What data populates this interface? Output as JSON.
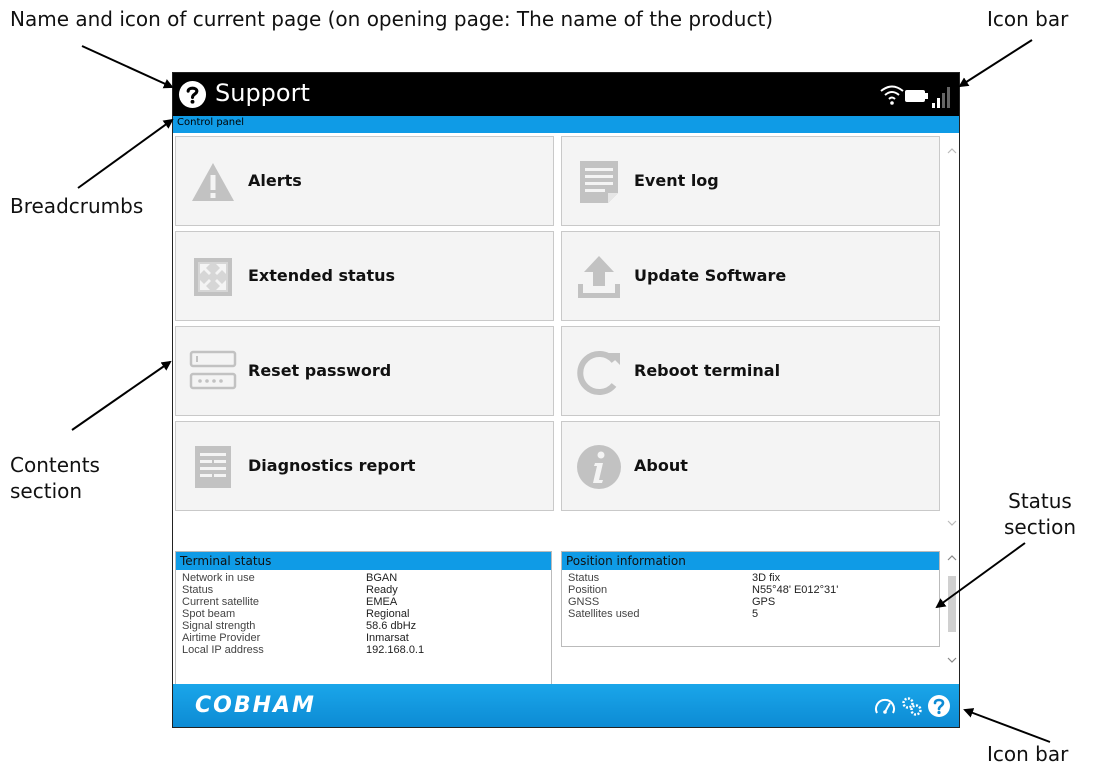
{
  "callouts": {
    "top_left": "Name and icon of current page (on opening page: The name of the product)",
    "icon_bar_top": "Icon bar",
    "breadcrumbs": "Breadcrumbs",
    "contents": "Contents section",
    "status": "Status section",
    "icon_bar_bottom": "Icon bar"
  },
  "titlebar": {
    "title": "Support",
    "icon": "question-circle-icon"
  },
  "top_icon_bar": [
    "wifi-icon",
    "battery-icon",
    "signal-bars-icon"
  ],
  "breadcrumb": "Control panel",
  "tiles": [
    {
      "label": "Alerts",
      "icon": "warning-triangle-icon"
    },
    {
      "label": "Event log",
      "icon": "document-icon"
    },
    {
      "label": "Extended status",
      "icon": "expand-arrows-icon"
    },
    {
      "label": "Update Software",
      "icon": "upload-icon"
    },
    {
      "label": "Reset password",
      "icon": "password-field-icon"
    },
    {
      "label": "Reboot terminal",
      "icon": "reboot-icon"
    },
    {
      "label": "Diagnostics report",
      "icon": "report-icon"
    },
    {
      "label": "About",
      "icon": "info-icon"
    }
  ],
  "terminal_status": {
    "title": "Terminal status",
    "rows": [
      {
        "k": "Network in use",
        "v": "BGAN"
      },
      {
        "k": "Status",
        "v": "Ready"
      },
      {
        "k": "Current satellite",
        "v": "EMEA"
      },
      {
        "k": "Spot beam",
        "v": "Regional"
      },
      {
        "k": "Signal strength",
        "v": "58.6 dbHz"
      },
      {
        "k": "Airtime Provider",
        "v": "Inmarsat"
      },
      {
        "k": "Local IP address",
        "v": "192.168.0.1"
      }
    ]
  },
  "position_info": {
    "title": "Position information",
    "rows": [
      {
        "k": "Status",
        "v": "3D fix"
      },
      {
        "k": "Position",
        "v": "N55°48' E012°31'"
      },
      {
        "k": "GNSS",
        "v": "GPS"
      },
      {
        "k": "Satellites used",
        "v": "5"
      }
    ]
  },
  "footer": {
    "logo": "COBHAM",
    "icons": [
      "dashboard-gauge-icon",
      "settings-gears-icon",
      "help-question-icon"
    ]
  },
  "colors": {
    "accent_blue": "#0f9be6",
    "title_bar": "#000000",
    "tile_bg": "#f4f4f4",
    "icon_gray": "#c2c2c2"
  }
}
